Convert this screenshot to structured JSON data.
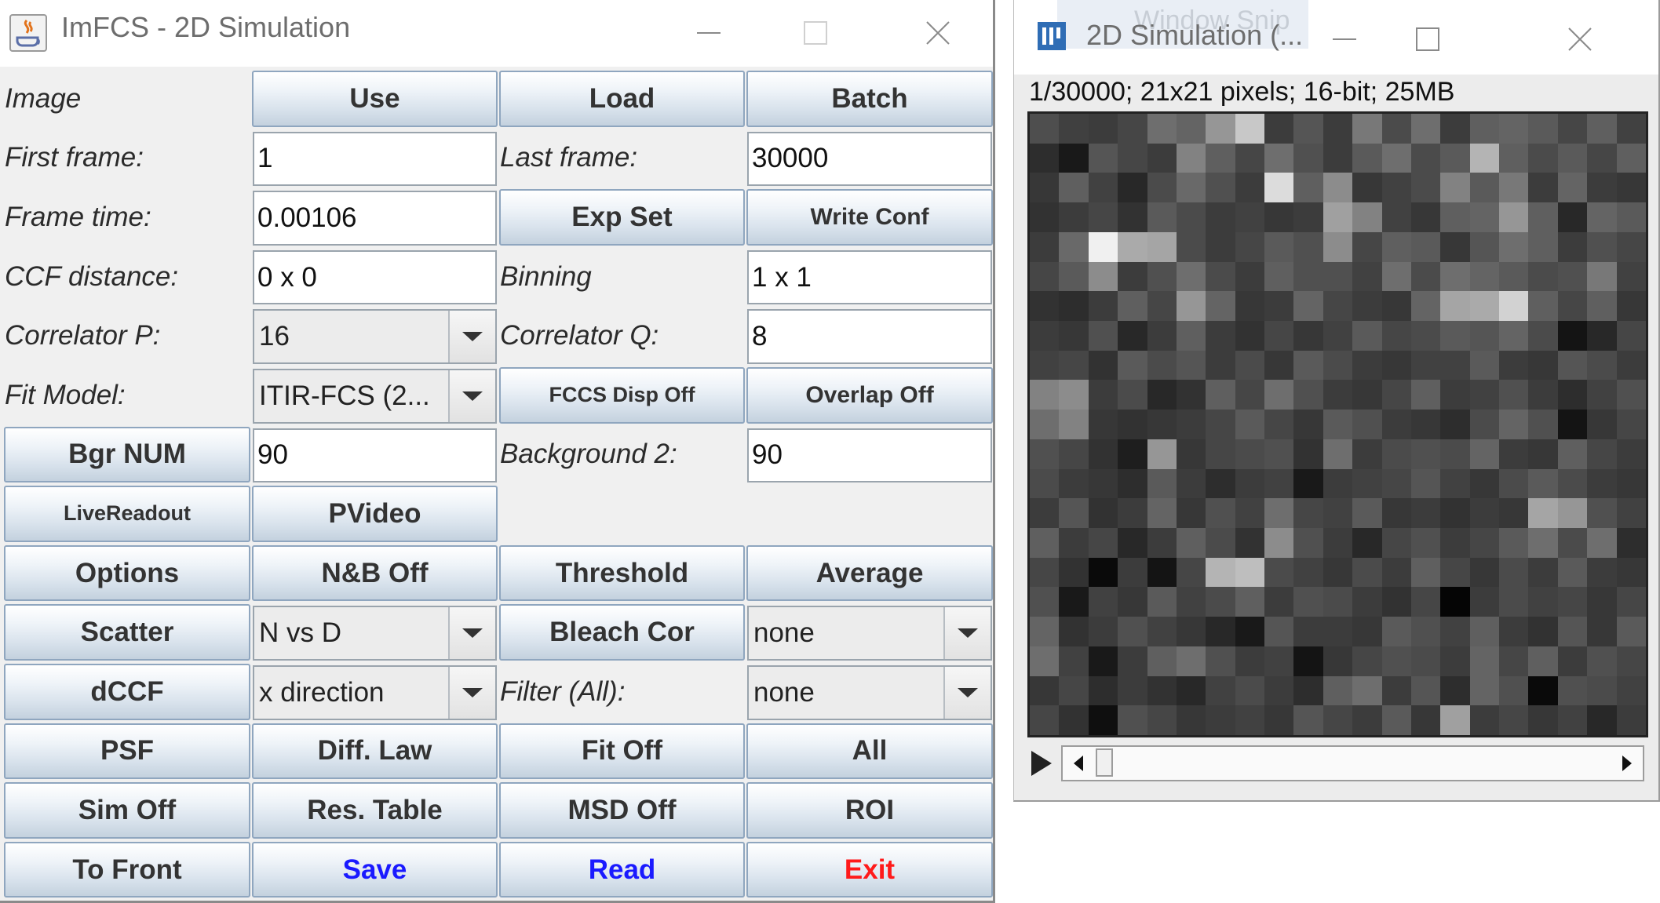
{
  "main_window": {
    "title": "ImFCS - 2D Simulation",
    "rows": [
      [
        {
          "t": "lbl",
          "v": "Image",
          "n": "image-label"
        },
        {
          "t": "btn",
          "v": "Use",
          "n": "use-button"
        },
        {
          "t": "btn",
          "v": "Load",
          "n": "load-button"
        },
        {
          "t": "btn",
          "v": "Batch",
          "n": "batch-button"
        }
      ],
      [
        {
          "t": "lbl",
          "v": "First frame:",
          "n": "first-frame-label"
        },
        {
          "t": "fld",
          "v": "1",
          "n": "first-frame-field"
        },
        {
          "t": "lbl",
          "v": "Last frame:",
          "n": "last-frame-label"
        },
        {
          "t": "fld",
          "v": "30000",
          "n": "last-frame-field"
        }
      ],
      [
        {
          "t": "lbl",
          "v": "Frame time:",
          "n": "frame-time-label"
        },
        {
          "t": "fld",
          "v": "0.00106",
          "n": "frame-time-field"
        },
        {
          "t": "btn",
          "v": "Exp Set",
          "n": "exp-set-button"
        },
        {
          "t": "btn",
          "v": "Write Conf",
          "n": "write-conf-button",
          "s": "sm"
        }
      ],
      [
        {
          "t": "lbl",
          "v": "CCF distance:",
          "n": "ccf-distance-label"
        },
        {
          "t": "fld",
          "v": "0 x 0",
          "n": "ccf-distance-field"
        },
        {
          "t": "lbl",
          "v": "Binning",
          "n": "binning-label"
        },
        {
          "t": "fld",
          "v": "1 x 1",
          "n": "binning-field"
        }
      ],
      [
        {
          "t": "lbl",
          "v": "Correlator P:",
          "n": "correlator-p-label"
        },
        {
          "t": "combo",
          "v": "16",
          "n": "correlator-p-select"
        },
        {
          "t": "lbl",
          "v": "Correlator Q:",
          "n": "correlator-q-label"
        },
        {
          "t": "fld",
          "v": "8",
          "n": "correlator-q-field"
        }
      ],
      [
        {
          "t": "lbl",
          "v": "Fit Model:",
          "n": "fit-model-label"
        },
        {
          "t": "combo",
          "v": "ITIR-FCS (2...",
          "n": "fit-model-select"
        },
        {
          "t": "btn",
          "v": "FCCS Disp Off",
          "n": "fccs-disp-button",
          "s": "xs"
        },
        {
          "t": "btn",
          "v": "Overlap Off",
          "n": "overlap-button",
          "s": "sm"
        }
      ],
      [
        {
          "t": "btn",
          "v": "Bgr NUM",
          "n": "bgr-num-button"
        },
        {
          "t": "fld",
          "v": "90",
          "n": "background-field"
        },
        {
          "t": "lbl",
          "v": "Background 2:",
          "n": "background-2-label"
        },
        {
          "t": "fld",
          "v": "90",
          "n": "background-2-field"
        }
      ],
      [
        {
          "t": "btn",
          "v": "LiveReadout",
          "n": "live-readout-button",
          "s": "xs"
        },
        {
          "t": "btn",
          "v": "PVideo",
          "n": "pvideo-button"
        },
        {
          "t": "empty"
        },
        {
          "t": "empty"
        }
      ],
      [
        {
          "t": "btn",
          "v": "Options",
          "n": "options-button"
        },
        {
          "t": "btn",
          "v": "N&B Off",
          "n": "nb-button"
        },
        {
          "t": "btn",
          "v": "Threshold",
          "n": "threshold-button"
        },
        {
          "t": "btn",
          "v": "Average",
          "n": "average-button"
        }
      ],
      [
        {
          "t": "btn",
          "v": "Scatter",
          "n": "scatter-button"
        },
        {
          "t": "combo",
          "v": "N vs D",
          "n": "scatter-select"
        },
        {
          "t": "btn",
          "v": "Bleach Cor",
          "n": "bleach-cor-button"
        },
        {
          "t": "combo",
          "v": "none",
          "n": "bleach-cor-select"
        }
      ],
      [
        {
          "t": "btn",
          "v": "dCCF",
          "n": "dccf-button"
        },
        {
          "t": "combo",
          "v": "x direction",
          "n": "dccf-direction-select"
        },
        {
          "t": "lbl",
          "v": "Filter (All):",
          "n": "filter-label"
        },
        {
          "t": "combo",
          "v": "none",
          "n": "filter-select"
        }
      ],
      [
        {
          "t": "btn",
          "v": "PSF",
          "n": "psf-button"
        },
        {
          "t": "btn",
          "v": "Diff. Law",
          "n": "diff-law-button"
        },
        {
          "t": "btn",
          "v": "Fit Off",
          "n": "fit-button"
        },
        {
          "t": "btn",
          "v": "All",
          "n": "all-button"
        }
      ],
      [
        {
          "t": "btn",
          "v": "Sim Off",
          "n": "sim-button"
        },
        {
          "t": "btn",
          "v": "Res. Table",
          "n": "res-table-button"
        },
        {
          "t": "btn",
          "v": "MSD Off",
          "n": "msd-button"
        },
        {
          "t": "btn",
          "v": "ROI",
          "n": "roi-button"
        }
      ],
      [
        {
          "t": "btn",
          "v": "To Front",
          "n": "to-front-button"
        },
        {
          "t": "btn",
          "v": "Save",
          "n": "save-button",
          "c": "#1a1aff"
        },
        {
          "t": "btn",
          "v": "Read",
          "n": "read-button",
          "c": "#1a1aff"
        },
        {
          "t": "btn",
          "v": "Exit",
          "n": "exit-button",
          "c": "#ff1a1a"
        }
      ]
    ]
  },
  "image_window": {
    "title": "2D Simulation (...",
    "ghost_title": "Window Snip",
    "info": "1/30000; 21x21 pixels; 16-bit; 25MB",
    "pixels": [
      [
        78,
        64,
        60,
        70,
        110,
        100,
        150,
        200,
        60,
        85,
        60,
        120,
        75,
        110,
        60,
        95,
        100,
        90,
        70,
        95,
        65
      ],
      [
        45,
        25,
        85,
        70,
        60,
        130,
        95,
        70,
        110,
        80,
        60,
        90,
        110,
        75,
        90,
        180,
        95,
        75,
        90,
        70,
        95
      ],
      [
        55,
        95,
        65,
        40,
        75,
        105,
        80,
        60,
        220,
        95,
        140,
        55,
        65,
        75,
        130,
        90,
        120,
        60,
        100,
        60,
        55
      ],
      [
        50,
        60,
        70,
        50,
        90,
        75,
        60,
        65,
        55,
        60,
        160,
        130,
        65,
        55,
        95,
        100,
        150,
        95,
        40,
        100,
        90
      ],
      [
        60,
        105,
        240,
        170,
        165,
        75,
        60,
        70,
        90,
        80,
        140,
        70,
        95,
        90,
        55,
        85,
        110,
        95,
        60,
        80,
        70
      ],
      [
        70,
        90,
        140,
        60,
        80,
        110,
        75,
        60,
        95,
        80,
        80,
        65,
        110,
        75,
        110,
        100,
        90,
        75,
        80,
        120,
        65
      ],
      [
        50,
        45,
        60,
        95,
        70,
        150,
        100,
        55,
        60,
        100,
        70,
        60,
        55,
        100,
        165,
        170,
        210,
        95,
        70,
        95,
        55
      ],
      [
        60,
        55,
        80,
        40,
        60,
        95,
        60,
        50,
        70,
        55,
        65,
        90,
        70,
        75,
        90,
        85,
        100,
        75,
        20,
        40,
        70
      ],
      [
        65,
        70,
        50,
        90,
        75,
        85,
        60,
        75,
        55,
        90,
        75,
        60,
        55,
        65,
        65,
        90,
        60,
        55,
        85,
        75,
        60
      ],
      [
        130,
        140,
        60,
        75,
        40,
        50,
        95,
        70,
        110,
        80,
        60,
        55,
        70,
        95,
        60,
        65,
        80,
        60,
        45,
        65,
        80
      ],
      [
        110,
        130,
        55,
        50,
        55,
        60,
        70,
        90,
        70,
        55,
        90,
        80,
        60,
        55,
        45,
        75,
        100,
        80,
        20,
        55,
        70
      ],
      [
        80,
        70,
        50,
        30,
        150,
        55,
        70,
        75,
        80,
        50,
        110,
        60,
        75,
        80,
        75,
        100,
        60,
        55,
        95,
        70,
        60
      ],
      [
        75,
        60,
        55,
        45,
        90,
        60,
        45,
        60,
        65,
        25,
        60,
        65,
        70,
        85,
        65,
        55,
        75,
        90,
        75,
        60,
        55
      ],
      [
        60,
        85,
        50,
        60,
        100,
        55,
        80,
        65,
        110,
        70,
        65,
        90,
        55,
        60,
        50,
        60,
        55,
        165,
        150,
        80,
        65
      ],
      [
        95,
        60,
        70,
        40,
        60,
        95,
        75,
        50,
        140,
        80,
        60,
        40,
        70,
        80,
        60,
        70,
        90,
        110,
        75,
        110,
        45
      ],
      [
        70,
        50,
        10,
        60,
        20,
        70,
        180,
        190,
        75,
        65,
        55,
        75,
        60,
        95,
        70,
        55,
        75,
        60,
        90,
        60,
        55
      ],
      [
        80,
        25,
        65,
        55,
        90,
        65,
        75,
        95,
        60,
        80,
        75,
        60,
        50,
        70,
        5,
        60,
        75,
        65,
        70,
        55,
        70
      ],
      [
        100,
        50,
        60,
        80,
        65,
        55,
        40,
        25,
        85,
        60,
        60,
        55,
        90,
        80,
        65,
        95,
        60,
        50,
        85,
        55,
        90
      ],
      [
        110,
        65,
        25,
        60,
        95,
        110,
        80,
        60,
        65,
        20,
        55,
        70,
        80,
        75,
        60,
        100,
        70,
        95,
        60,
        80,
        70
      ],
      [
        55,
        70,
        45,
        60,
        50,
        40,
        65,
        75,
        60,
        45,
        95,
        110,
        60,
        85,
        45,
        100,
        80,
        10,
        80,
        75,
        65
      ],
      [
        70,
        50,
        15,
        80,
        70,
        55,
        60,
        65,
        55,
        85,
        70,
        60,
        90,
        55,
        160,
        60,
        70,
        55,
        65,
        40,
        60
      ]
    ]
  }
}
